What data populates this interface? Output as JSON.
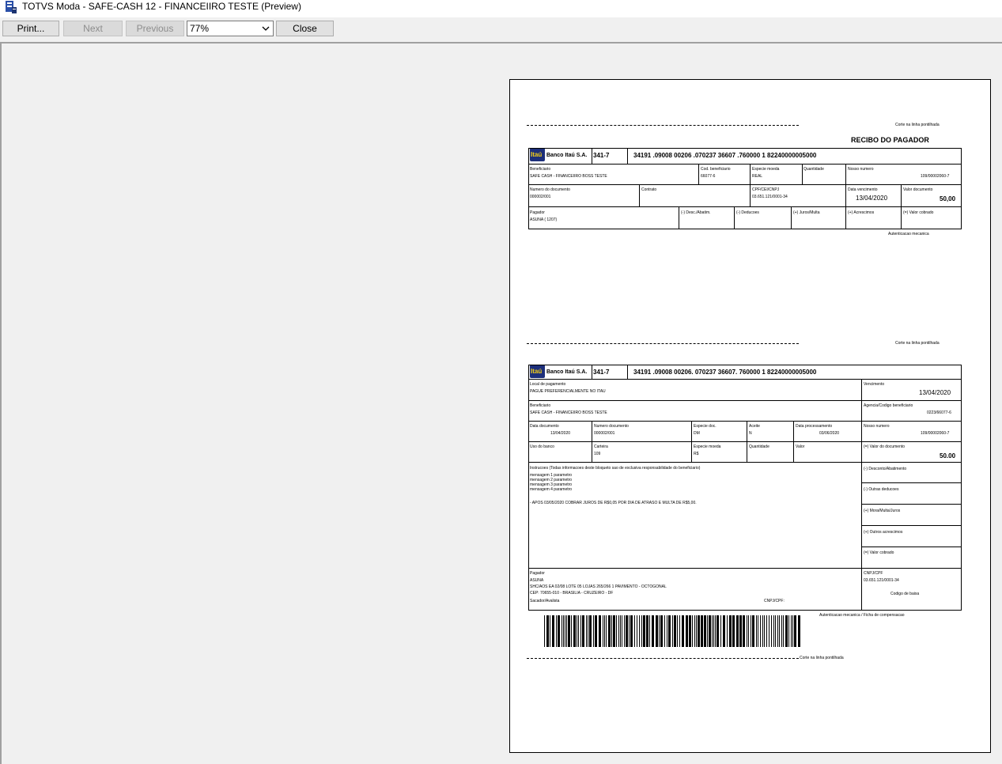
{
  "window": {
    "title": "TOTVS Moda - SAFE-CASH 12 - FINANCEIIRO TESTE (Preview)"
  },
  "toolbar": {
    "print": "Print...",
    "next": "Next",
    "previous": "Previous",
    "zoom": "77%",
    "close": "Close"
  },
  "receipt": {
    "cut_text": "Corte na linha pontilhada",
    "title": "RECIBO DO PAGADOR",
    "bank_name": "Banco Itaú S.A.",
    "logo_text": "Itaú",
    "bank_code": "341-7",
    "digitable_line": "34191 .09008  00206 .070237  36607 .760000  1  82240000005000",
    "beneficiario_label": "Beneficiario",
    "beneficiario": "SAFE CASH - FINANCEIIRO BOSS TESTE",
    "cod_beneficiario_label": "Cod. beneficiario",
    "cod_beneficiario": "66077-6",
    "especie_moeda_label": "Especie moeda",
    "especie_moeda": "REAL",
    "quantidade_label": "Quantidade",
    "nosso_numero_label": "Nosso numero",
    "nosso_numero": "109/00002060-7",
    "num_documento_label": "Numero do documento",
    "num_documento": "000002/001",
    "contrato_label": "Contrato",
    "cpf_label": "CPF/CEI/CNPJ",
    "cpf": "03.651.121/0001-34",
    "vencimento_label": "Data vencimento",
    "vencimento": "13/04/2020",
    "valor_documento_label": "Valor documento",
    "valor_documento": "50,00",
    "pagador_label": "Pagador",
    "pagador": "ASUNA ( 1207)",
    "desc_label": "(-) Desc./Abatim.",
    "deducoes_label": "(-) Deducoes",
    "juros_label": "(+) Juros/Multa",
    "acrescimos_label": "(+) Acrescimos",
    "valor_cobrado_label": "(=) Valor cobrado",
    "autenticacao": "Autenticacao mecanica"
  },
  "slip": {
    "cut_text": "Corte na linha pontilhada",
    "bank_name": "Banco Itaú S.A.",
    "logo_text": "Itaú",
    "bank_code": "341-7",
    "digitable_line": "34191 .09008  00206. 070237  36607. 760000  1  82240000005000",
    "local_label": "Local de pagamento",
    "local": "PAGUE PREFERENCIALMENTE NO ITAU",
    "vencimento_label": "Vencimento",
    "vencimento": "13/04/2020",
    "beneficiario_label": "Beneficiario",
    "beneficiario": "SAFE CASH - FINANCEIIRO BOSS TESTE",
    "agencia_label": "Agencia/Codigo beneficiario",
    "agencia": "0223/66077-6",
    "data_doc_label": "Data documento",
    "data_doc": "13/04/2020",
    "num_doc_label": "Numero documento",
    "num_doc": "000002/001",
    "especie_doc_label": "Especie doc.",
    "especie_doc": "DM",
    "aceite_label": "Aceite",
    "aceite": "N",
    "data_proc_label": "Data processamento",
    "data_proc": "03/06/2020",
    "nosso_numero_label": "Nosso numero",
    "nosso_numero": "109/00002060-7",
    "uso_banco_label": "Uso do banco",
    "carteira_label": "Carteira",
    "carteira": "109",
    "especie_moeda_label": "Especie moeda",
    "especie_moeda": "R$",
    "quantidade_label": "Quantidade",
    "valor_label": "Valor",
    "valor_doc_label": "(=) Valor do documento",
    "valor_doc": "50.00",
    "instrucoes_label": "Instrucoes (Todas informacoes deste bloqueto sao de exclusiva responsabilidade do beneficiario)",
    "msg1": "mensagem 1 parametro",
    "msg2": "mensagem 2 parametro",
    "msg3": "mensagem 3 parametro",
    "msg4": "mensagem 4 parametro",
    "juros_msg": "- APOS 03/05/2020 COBRAR JUROS DE R$0,05 POR DIA DE ATRASO E MULTA DE R$5,00.",
    "desconto_label": "(-) Desconto/Abatimento",
    "outras_deducoes_label": "(-) Outras deducoes",
    "mora_label": "(+) Mora/Multa/Juros",
    "outros_acrescimos_label": "(+) Outros acrescimos",
    "valor_cobrado_label": "(=) Valor cobrado",
    "pagador_label": "Pagador",
    "pagador_nome": "ASUNA",
    "pagador_end": "SHC/AOS EA 02/08 LOTE 05 LOJAS 265/266   1 PAVIMENTO - OCTOGONAL",
    "pagador_cep": "CEP: 70655-010 - BRASILIA - CRUZEIRO - DF",
    "sacador_label": "Sacador/Avalista",
    "cnpj_cpf_label": "CNPJ/CPF:",
    "cnpj_right_label": "CNPJ/CPF",
    "cnpj_right": "03.651.121/0001-34",
    "codigo_baixa": "Codigo de baixa",
    "autenticacao": "Autenticacao mecanica / Ficha de compensacao",
    "bottom_cut": "Corte na linha pontilhada"
  }
}
